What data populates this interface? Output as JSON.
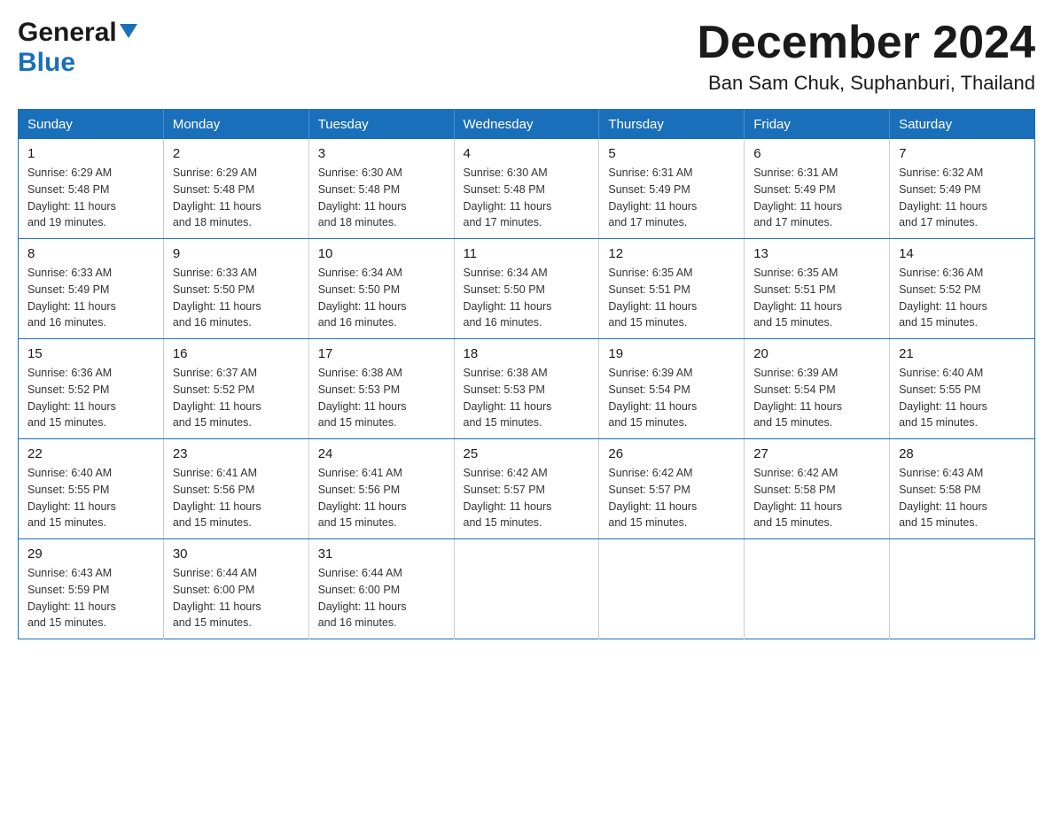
{
  "logo": {
    "general": "General",
    "blue": "Blue"
  },
  "header": {
    "month_title": "December 2024",
    "location": "Ban Sam Chuk, Suphanburi, Thailand"
  },
  "days_of_week": [
    "Sunday",
    "Monday",
    "Tuesday",
    "Wednesday",
    "Thursday",
    "Friday",
    "Saturday"
  ],
  "weeks": [
    {
      "days": [
        {
          "number": "1",
          "sunrise": "6:29 AM",
          "sunset": "5:48 PM",
          "daylight": "11 hours and 19 minutes."
        },
        {
          "number": "2",
          "sunrise": "6:29 AM",
          "sunset": "5:48 PM",
          "daylight": "11 hours and 18 minutes."
        },
        {
          "number": "3",
          "sunrise": "6:30 AM",
          "sunset": "5:48 PM",
          "daylight": "11 hours and 18 minutes."
        },
        {
          "number": "4",
          "sunrise": "6:30 AM",
          "sunset": "5:48 PM",
          "daylight": "11 hours and 17 minutes."
        },
        {
          "number": "5",
          "sunrise": "6:31 AM",
          "sunset": "5:49 PM",
          "daylight": "11 hours and 17 minutes."
        },
        {
          "number": "6",
          "sunrise": "6:31 AM",
          "sunset": "5:49 PM",
          "daylight": "11 hours and 17 minutes."
        },
        {
          "number": "7",
          "sunrise": "6:32 AM",
          "sunset": "5:49 PM",
          "daylight": "11 hours and 17 minutes."
        }
      ]
    },
    {
      "days": [
        {
          "number": "8",
          "sunrise": "6:33 AM",
          "sunset": "5:49 PM",
          "daylight": "11 hours and 16 minutes."
        },
        {
          "number": "9",
          "sunrise": "6:33 AM",
          "sunset": "5:50 PM",
          "daylight": "11 hours and 16 minutes."
        },
        {
          "number": "10",
          "sunrise": "6:34 AM",
          "sunset": "5:50 PM",
          "daylight": "11 hours and 16 minutes."
        },
        {
          "number": "11",
          "sunrise": "6:34 AM",
          "sunset": "5:50 PM",
          "daylight": "11 hours and 16 minutes."
        },
        {
          "number": "12",
          "sunrise": "6:35 AM",
          "sunset": "5:51 PM",
          "daylight": "11 hours and 15 minutes."
        },
        {
          "number": "13",
          "sunrise": "6:35 AM",
          "sunset": "5:51 PM",
          "daylight": "11 hours and 15 minutes."
        },
        {
          "number": "14",
          "sunrise": "6:36 AM",
          "sunset": "5:52 PM",
          "daylight": "11 hours and 15 minutes."
        }
      ]
    },
    {
      "days": [
        {
          "number": "15",
          "sunrise": "6:36 AM",
          "sunset": "5:52 PM",
          "daylight": "11 hours and 15 minutes."
        },
        {
          "number": "16",
          "sunrise": "6:37 AM",
          "sunset": "5:52 PM",
          "daylight": "11 hours and 15 minutes."
        },
        {
          "number": "17",
          "sunrise": "6:38 AM",
          "sunset": "5:53 PM",
          "daylight": "11 hours and 15 minutes."
        },
        {
          "number": "18",
          "sunrise": "6:38 AM",
          "sunset": "5:53 PM",
          "daylight": "11 hours and 15 minutes."
        },
        {
          "number": "19",
          "sunrise": "6:39 AM",
          "sunset": "5:54 PM",
          "daylight": "11 hours and 15 minutes."
        },
        {
          "number": "20",
          "sunrise": "6:39 AM",
          "sunset": "5:54 PM",
          "daylight": "11 hours and 15 minutes."
        },
        {
          "number": "21",
          "sunrise": "6:40 AM",
          "sunset": "5:55 PM",
          "daylight": "11 hours and 15 minutes."
        }
      ]
    },
    {
      "days": [
        {
          "number": "22",
          "sunrise": "6:40 AM",
          "sunset": "5:55 PM",
          "daylight": "11 hours and 15 minutes."
        },
        {
          "number": "23",
          "sunrise": "6:41 AM",
          "sunset": "5:56 PM",
          "daylight": "11 hours and 15 minutes."
        },
        {
          "number": "24",
          "sunrise": "6:41 AM",
          "sunset": "5:56 PM",
          "daylight": "11 hours and 15 minutes."
        },
        {
          "number": "25",
          "sunrise": "6:42 AM",
          "sunset": "5:57 PM",
          "daylight": "11 hours and 15 minutes."
        },
        {
          "number": "26",
          "sunrise": "6:42 AM",
          "sunset": "5:57 PM",
          "daylight": "11 hours and 15 minutes."
        },
        {
          "number": "27",
          "sunrise": "6:42 AM",
          "sunset": "5:58 PM",
          "daylight": "11 hours and 15 minutes."
        },
        {
          "number": "28",
          "sunrise": "6:43 AM",
          "sunset": "5:58 PM",
          "daylight": "11 hours and 15 minutes."
        }
      ]
    },
    {
      "days": [
        {
          "number": "29",
          "sunrise": "6:43 AM",
          "sunset": "5:59 PM",
          "daylight": "11 hours and 15 minutes."
        },
        {
          "number": "30",
          "sunrise": "6:44 AM",
          "sunset": "6:00 PM",
          "daylight": "11 hours and 15 minutes."
        },
        {
          "number": "31",
          "sunrise": "6:44 AM",
          "sunset": "6:00 PM",
          "daylight": "11 hours and 16 minutes."
        },
        null,
        null,
        null,
        null
      ]
    }
  ],
  "labels": {
    "sunrise": "Sunrise:",
    "sunset": "Sunset:",
    "daylight": "Daylight:"
  }
}
